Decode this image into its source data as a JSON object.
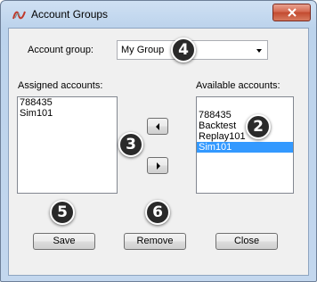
{
  "window": {
    "title": "Account Groups",
    "close_glyph": "✕"
  },
  "form": {
    "account_group_label": "Account group:",
    "account_group_value": "My Group",
    "assigned_label": "Assigned accounts:",
    "available_label": "Available accounts:"
  },
  "assigned_accounts": [
    "788435",
    "Sim101"
  ],
  "available_accounts": [
    "788435",
    "Backtest",
    "Replay101",
    "Sim101"
  ],
  "available_selected": "Sim101",
  "buttons": {
    "save": "Save",
    "remove": "Remove",
    "close": "Close"
  },
  "badges": {
    "b2": "2",
    "b3": "3",
    "b4": "4",
    "b5": "5",
    "b6": "6"
  },
  "colors": {
    "selection": "#3399ff",
    "close_button": "#c24a2f"
  },
  "icons": {
    "app": "app-logo-icon",
    "close": "close-icon",
    "move_left": "arrow-left-icon",
    "move_right": "arrow-right-icon",
    "dropdown": "chevron-down-icon"
  }
}
